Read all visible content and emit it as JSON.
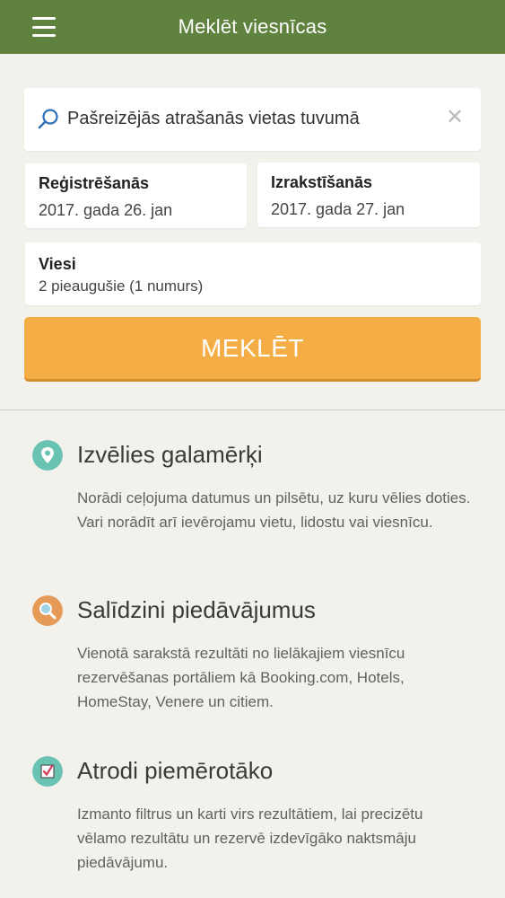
{
  "header": {
    "title": "Meklēt viesnīcas"
  },
  "search": {
    "placeholder": "Pašreizējās atrašanās vietas tuvumā"
  },
  "checkin": {
    "label": "Reģistrēšanās",
    "value": "2017. gada 26. jan"
  },
  "checkout": {
    "label": "Izrakstīšanās",
    "value": "2017. gada 27. jan"
  },
  "guests": {
    "label": "Viesi",
    "value": "2 pieaugušie (1 numurs)"
  },
  "search_button": "MEKLĒT",
  "features": [
    {
      "icon": "location-pin-icon",
      "color": "#6ac2b3",
      "title": "Izvēlies galamērķi",
      "desc": "Norādi ceļojuma datumus un pilsētu, uz kuru vēlies doties. Vari norādīt arī ievērojamu vietu, lidostu vai viesnīcu."
    },
    {
      "icon": "magnifier-icon",
      "color": "#e69a58",
      "title": "Salīdzini piedāvājumus",
      "desc": "Vienotā sarakstā rezultāti no lielākajiem viesnīcu rezervēšanas portāliem kā Booking.com, Hotels, HomeStay, Venere un citiem."
    },
    {
      "icon": "checkbox-icon",
      "color": "#6ac2b3",
      "title": "Atrodi piemērotāko",
      "desc": "Izmanto filtrus un karti virs rezultātiem, lai precizētu vēlamo rezultātu un rezervē izdevīgāko naktsmāju piedāvājumu."
    }
  ],
  "colors": {
    "header": "#5f823f",
    "button": "#f5ae45",
    "background": "#f2f1ec"
  }
}
